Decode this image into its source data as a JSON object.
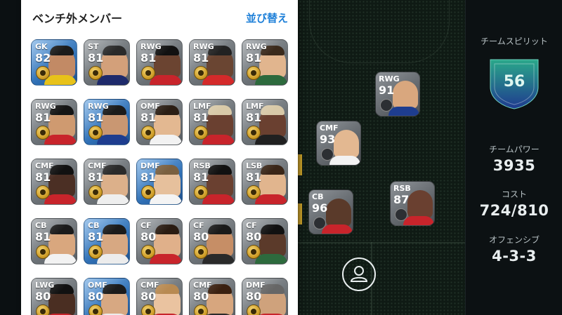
{
  "bench": {
    "title": "ベンチ外メンバー",
    "sort_label": "並び替え",
    "cards": [
      {
        "pos": "GK",
        "ovr": "82",
        "bg": "blue",
        "skin": "#c28a65",
        "shirt": "#e8c21a",
        "hair": "#1b1b1b"
      },
      {
        "pos": "ST",
        "ovr": "81",
        "bg": "gray",
        "skin": "#d3a07a",
        "shirt": "#1e2a6b",
        "hair": "#2a2a2a"
      },
      {
        "pos": "RWG",
        "ovr": "81",
        "bg": "gray",
        "skin": "#6b4431",
        "shirt": "#c8242b",
        "hair": "#111111"
      },
      {
        "pos": "RWG",
        "ovr": "81",
        "bg": "gray",
        "skin": "#6a4532",
        "shirt": "#d42a2a",
        "hair": "#222222"
      },
      {
        "pos": "RWG",
        "ovr": "81",
        "bg": "gray",
        "skin": "#e1b58e",
        "shirt": "#2d6a3d",
        "hair": "#3a2a1c"
      },
      {
        "pos": "RWG",
        "ovr": "81",
        "bg": "gray",
        "skin": "#cf9a70",
        "shirt": "#c8242b",
        "hair": "#151515"
      },
      {
        "pos": "RWG",
        "ovr": "81",
        "bg": "blue",
        "skin": "#c99772",
        "shirt": "#1e3d8f",
        "hair": "#1b1b1b"
      },
      {
        "pos": "OMF",
        "ovr": "81",
        "bg": "gray",
        "skin": "#e3b891",
        "shirt": "#f2f2f2",
        "hair": "#2b1e14"
      },
      {
        "pos": "LMF",
        "ovr": "81",
        "bg": "gray",
        "skin": "#6a4030",
        "shirt": "#c8242b",
        "hair": "#d8c9a8"
      },
      {
        "pos": "LMF",
        "ovr": "81",
        "bg": "gray",
        "skin": "#6a4030",
        "shirt": "#202020",
        "hair": "#d8c9a8"
      },
      {
        "pos": "CMF",
        "ovr": "81",
        "bg": "gray",
        "skin": "#4b2f24",
        "shirt": "#c8242b",
        "hair": "#111111"
      },
      {
        "pos": "CMF",
        "ovr": "81",
        "bg": "gray",
        "skin": "#dcb08a",
        "shirt": "#eeeeee",
        "hair": "#2a2a2a"
      },
      {
        "pos": "DMF",
        "ovr": "81",
        "bg": "blue",
        "skin": "#e6c09c",
        "shirt": "#f4f4f4",
        "hair": "#7a6040"
      },
      {
        "pos": "RSB",
        "ovr": "81",
        "bg": "gray",
        "skin": "#6a4030",
        "shirt": "#c8242b",
        "hair": "#111111"
      },
      {
        "pos": "LSB",
        "ovr": "81",
        "bg": "gray",
        "skin": "#e1b58e",
        "shirt": "#c8242b",
        "hair": "#3a2618"
      },
      {
        "pos": "CB",
        "ovr": "81",
        "bg": "gray",
        "skin": "#d9a77e",
        "shirt": "#f2f2f2",
        "hair": "#1b1b1b"
      },
      {
        "pos": "CB",
        "ovr": "81",
        "bg": "blue",
        "skin": "#d7a882",
        "shirt": "#ececec",
        "hair": "#1b1b1b"
      },
      {
        "pos": "CF",
        "ovr": "80",
        "bg": "gray",
        "skin": "#e0b08a",
        "shirt": "#c8242b",
        "hair": "#2a1c12"
      },
      {
        "pos": "CF",
        "ovr": "80",
        "bg": "gray",
        "skin": "#c68e66",
        "shirt": "#2a2a2a",
        "hair": "#1a1a1a"
      },
      {
        "pos": "CF",
        "ovr": "80",
        "bg": "gray",
        "skin": "#5b3a2a",
        "shirt": "#2d6a3d",
        "hair": "#111111"
      },
      {
        "pos": "LWG",
        "ovr": "80",
        "bg": "gray",
        "skin": "#4a2e22",
        "shirt": "#c8242b",
        "hair": "#111111"
      },
      {
        "pos": "OMF",
        "ovr": "80",
        "bg": "blue",
        "skin": "#d7a882",
        "shirt": "#ececec",
        "hair": "#1b1b1b"
      },
      {
        "pos": "CMF",
        "ovr": "80",
        "bg": "gray",
        "skin": "#eac3a0",
        "shirt": "#c8242b",
        "hair": "#b88a52"
      },
      {
        "pos": "CMF",
        "ovr": "80",
        "bg": "gray",
        "skin": "#d7a67e",
        "shirt": "#2a2a2a",
        "hair": "#3a2010"
      },
      {
        "pos": "DMF",
        "ovr": "80",
        "bg": "gray",
        "skin": "#cfa27c",
        "shirt": "#c8242b",
        "hair": "#666666"
      }
    ]
  },
  "pitch_players": [
    {
      "pos": "RWG",
      "ovr": "91",
      "skin": "#d9a77e",
      "shirt": "#1e3d8f"
    },
    {
      "pos": "CMF",
      "ovr": "93",
      "skin": "#e3b891",
      "shirt": "#f2f2f2"
    },
    {
      "pos": "CB",
      "ovr": "96",
      "skin": "#5a3a2a",
      "shirt": "#c8242b"
    },
    {
      "pos": "RSB",
      "ovr": "87",
      "skin": "#6a4030",
      "shirt": "#c8242b"
    }
  ],
  "stats": {
    "team_spirit_label": "チームスピリット",
    "team_spirit_value": "56",
    "team_power_label": "チームパワー",
    "team_power_value": "3935",
    "cost_label": "コスト",
    "cost_value": "724/810",
    "offense_label": "オフェンシブ",
    "formation_value": "4-3-3"
  },
  "colors": {
    "accent": "#1d7fd8",
    "shield_top": "#2aa88a",
    "shield_bottom": "#1f3a8f"
  }
}
